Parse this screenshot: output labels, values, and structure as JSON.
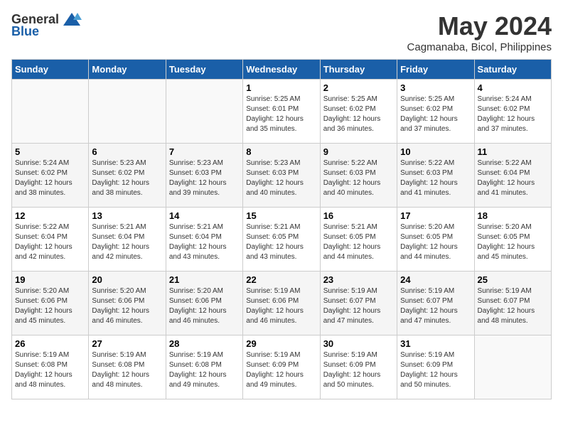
{
  "header": {
    "logo_general": "General",
    "logo_blue": "Blue",
    "month_year": "May 2024",
    "location": "Cagmanaba, Bicol, Philippines"
  },
  "weekdays": [
    "Sunday",
    "Monday",
    "Tuesday",
    "Wednesday",
    "Thursday",
    "Friday",
    "Saturday"
  ],
  "weeks": [
    [
      {
        "day": "",
        "info": ""
      },
      {
        "day": "",
        "info": ""
      },
      {
        "day": "",
        "info": ""
      },
      {
        "day": "1",
        "info": "Sunrise: 5:25 AM\nSunset: 6:01 PM\nDaylight: 12 hours\nand 35 minutes."
      },
      {
        "day": "2",
        "info": "Sunrise: 5:25 AM\nSunset: 6:02 PM\nDaylight: 12 hours\nand 36 minutes."
      },
      {
        "day": "3",
        "info": "Sunrise: 5:25 AM\nSunset: 6:02 PM\nDaylight: 12 hours\nand 37 minutes."
      },
      {
        "day": "4",
        "info": "Sunrise: 5:24 AM\nSunset: 6:02 PM\nDaylight: 12 hours\nand 37 minutes."
      }
    ],
    [
      {
        "day": "5",
        "info": "Sunrise: 5:24 AM\nSunset: 6:02 PM\nDaylight: 12 hours\nand 38 minutes."
      },
      {
        "day": "6",
        "info": "Sunrise: 5:23 AM\nSunset: 6:02 PM\nDaylight: 12 hours\nand 38 minutes."
      },
      {
        "day": "7",
        "info": "Sunrise: 5:23 AM\nSunset: 6:03 PM\nDaylight: 12 hours\nand 39 minutes."
      },
      {
        "day": "8",
        "info": "Sunrise: 5:23 AM\nSunset: 6:03 PM\nDaylight: 12 hours\nand 40 minutes."
      },
      {
        "day": "9",
        "info": "Sunrise: 5:22 AM\nSunset: 6:03 PM\nDaylight: 12 hours\nand 40 minutes."
      },
      {
        "day": "10",
        "info": "Sunrise: 5:22 AM\nSunset: 6:03 PM\nDaylight: 12 hours\nand 41 minutes."
      },
      {
        "day": "11",
        "info": "Sunrise: 5:22 AM\nSunset: 6:04 PM\nDaylight: 12 hours\nand 41 minutes."
      }
    ],
    [
      {
        "day": "12",
        "info": "Sunrise: 5:22 AM\nSunset: 6:04 PM\nDaylight: 12 hours\nand 42 minutes."
      },
      {
        "day": "13",
        "info": "Sunrise: 5:21 AM\nSunset: 6:04 PM\nDaylight: 12 hours\nand 42 minutes."
      },
      {
        "day": "14",
        "info": "Sunrise: 5:21 AM\nSunset: 6:04 PM\nDaylight: 12 hours\nand 43 minutes."
      },
      {
        "day": "15",
        "info": "Sunrise: 5:21 AM\nSunset: 6:05 PM\nDaylight: 12 hours\nand 43 minutes."
      },
      {
        "day": "16",
        "info": "Sunrise: 5:21 AM\nSunset: 6:05 PM\nDaylight: 12 hours\nand 44 minutes."
      },
      {
        "day": "17",
        "info": "Sunrise: 5:20 AM\nSunset: 6:05 PM\nDaylight: 12 hours\nand 44 minutes."
      },
      {
        "day": "18",
        "info": "Sunrise: 5:20 AM\nSunset: 6:05 PM\nDaylight: 12 hours\nand 45 minutes."
      }
    ],
    [
      {
        "day": "19",
        "info": "Sunrise: 5:20 AM\nSunset: 6:06 PM\nDaylight: 12 hours\nand 45 minutes."
      },
      {
        "day": "20",
        "info": "Sunrise: 5:20 AM\nSunset: 6:06 PM\nDaylight: 12 hours\nand 46 minutes."
      },
      {
        "day": "21",
        "info": "Sunrise: 5:20 AM\nSunset: 6:06 PM\nDaylight: 12 hours\nand 46 minutes."
      },
      {
        "day": "22",
        "info": "Sunrise: 5:19 AM\nSunset: 6:06 PM\nDaylight: 12 hours\nand 46 minutes."
      },
      {
        "day": "23",
        "info": "Sunrise: 5:19 AM\nSunset: 6:07 PM\nDaylight: 12 hours\nand 47 minutes."
      },
      {
        "day": "24",
        "info": "Sunrise: 5:19 AM\nSunset: 6:07 PM\nDaylight: 12 hours\nand 47 minutes."
      },
      {
        "day": "25",
        "info": "Sunrise: 5:19 AM\nSunset: 6:07 PM\nDaylight: 12 hours\nand 48 minutes."
      }
    ],
    [
      {
        "day": "26",
        "info": "Sunrise: 5:19 AM\nSunset: 6:08 PM\nDaylight: 12 hours\nand 48 minutes."
      },
      {
        "day": "27",
        "info": "Sunrise: 5:19 AM\nSunset: 6:08 PM\nDaylight: 12 hours\nand 48 minutes."
      },
      {
        "day": "28",
        "info": "Sunrise: 5:19 AM\nSunset: 6:08 PM\nDaylight: 12 hours\nand 49 minutes."
      },
      {
        "day": "29",
        "info": "Sunrise: 5:19 AM\nSunset: 6:09 PM\nDaylight: 12 hours\nand 49 minutes."
      },
      {
        "day": "30",
        "info": "Sunrise: 5:19 AM\nSunset: 6:09 PM\nDaylight: 12 hours\nand 50 minutes."
      },
      {
        "day": "31",
        "info": "Sunrise: 5:19 AM\nSunset: 6:09 PM\nDaylight: 12 hours\nand 50 minutes."
      },
      {
        "day": "",
        "info": ""
      }
    ]
  ]
}
